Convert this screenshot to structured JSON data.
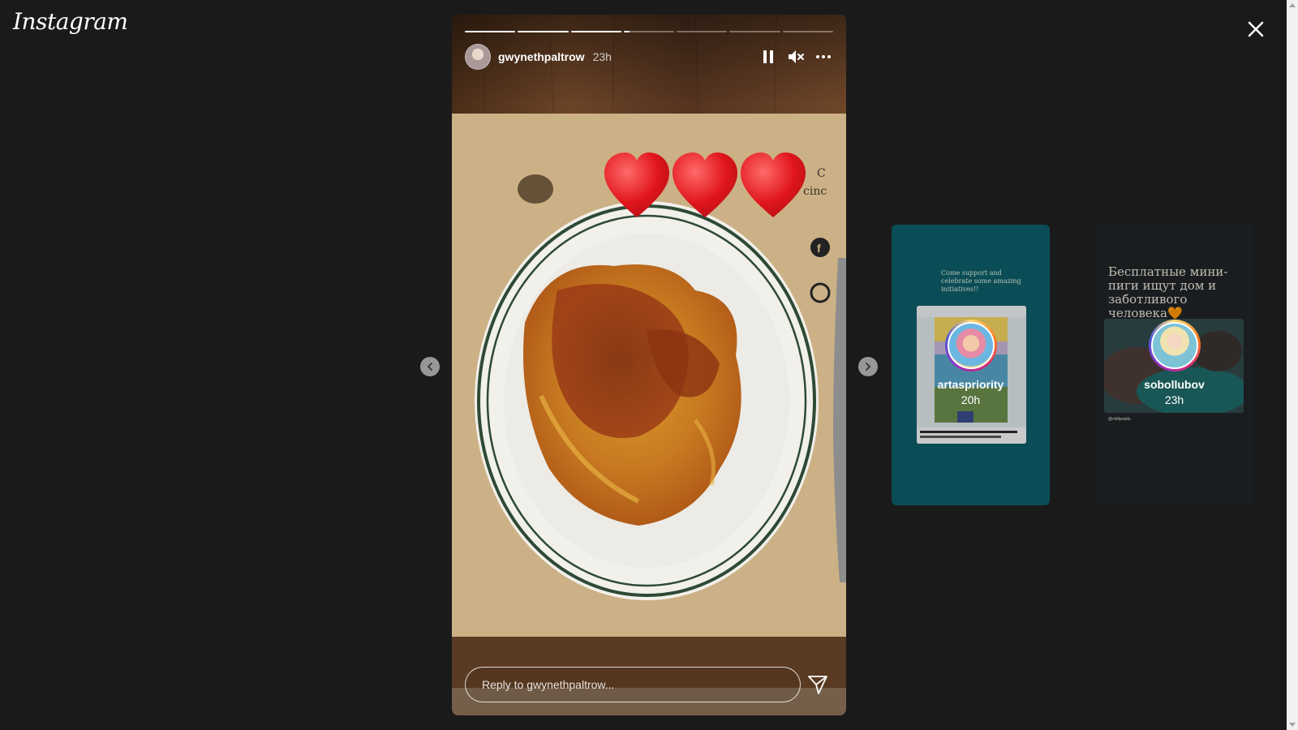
{
  "app": {
    "logo": "Instagram"
  },
  "story": {
    "username": "gwynethpaltrow",
    "time_ago": "23h",
    "segments_total": 7,
    "segments_completed": 3,
    "current_segment_progress": 0.12,
    "reply_placeholder": "Reply to gwynethpaltrow...",
    "stickers": [
      "heart",
      "heart",
      "heart"
    ]
  },
  "previews": [
    {
      "username": "artaspriority",
      "time_ago": "20h",
      "caption": "Come support and celebrate some amazing initiatives!!",
      "colors": {
        "background": "#0e5f6a"
      }
    },
    {
      "username": "sobollubov",
      "time_ago": "23h",
      "caption": "Бесплатные мини-пиги ищут дом и заботливого человека🧡",
      "credit": "@chillysvids",
      "colors": {
        "background": "#202428"
      }
    }
  ],
  "icons": {
    "close": "close-icon",
    "pause": "pause-icon",
    "mute": "muted-speaker-icon",
    "more": "more-options-icon",
    "send": "send-icon",
    "prev": "chevron-left-icon",
    "next": "chevron-right-icon"
  }
}
